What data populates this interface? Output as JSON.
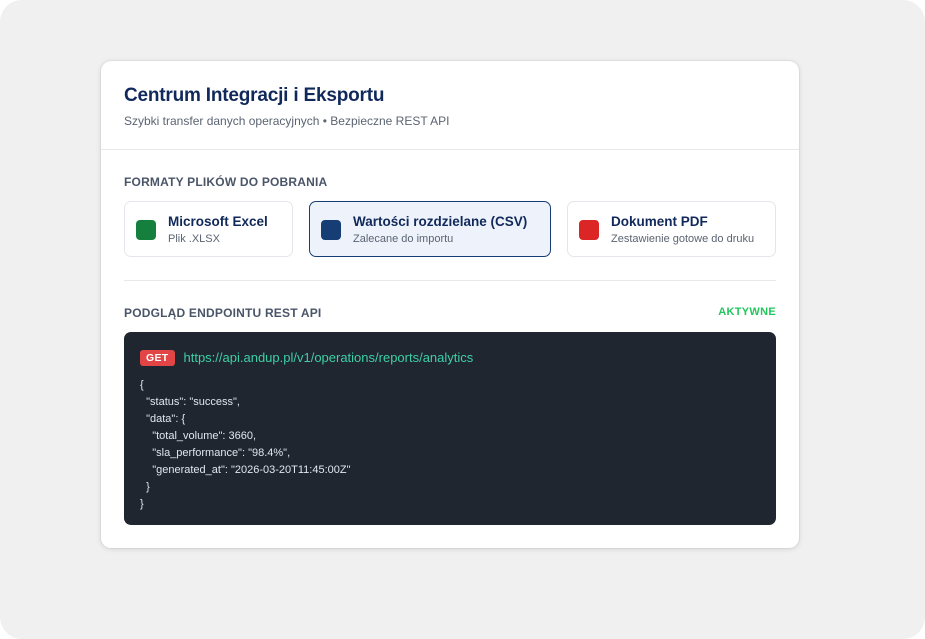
{
  "header": {
    "title": "Centrum Integracji i Eksportu",
    "subtitle": "Szybki transfer danych operacyjnych • Bezpieczne REST API"
  },
  "formats": {
    "label": "FORMATY PLIKÓW DO POBRANIA",
    "items": [
      {
        "name": "Microsoft Excel",
        "desc": "Plik .XLSX",
        "color": "#15803d",
        "selected": false
      },
      {
        "name": "Wartości rozdzielane (CSV)",
        "desc": "Zalecane do importu",
        "color": "#163e74",
        "selected": true
      },
      {
        "name": "Dokument PDF",
        "desc": "Zestawienie gotowe do druku",
        "color": "#dc2626",
        "selected": false
      }
    ]
  },
  "api": {
    "label": "PODGLĄD ENDPOINTU REST API",
    "status": "AKTYWNE",
    "method": "GET",
    "url": "https://api.andup.pl/v1/operations/reports/analytics",
    "json_lines": [
      "{",
      "  \"status\": \"success\",",
      "  \"data\": {",
      "    \"total_volume\": 3660,",
      "    \"sla_performance\": \"98.4%\",",
      "    \"generated_at\": \"2026-03-20T11:45:00Z\"",
      "  }",
      "}"
    ]
  },
  "colors": {
    "accent_navy": "#11295a",
    "active_green": "#22c55e",
    "method_red": "#e24545",
    "url_teal": "#3ecfa5"
  }
}
